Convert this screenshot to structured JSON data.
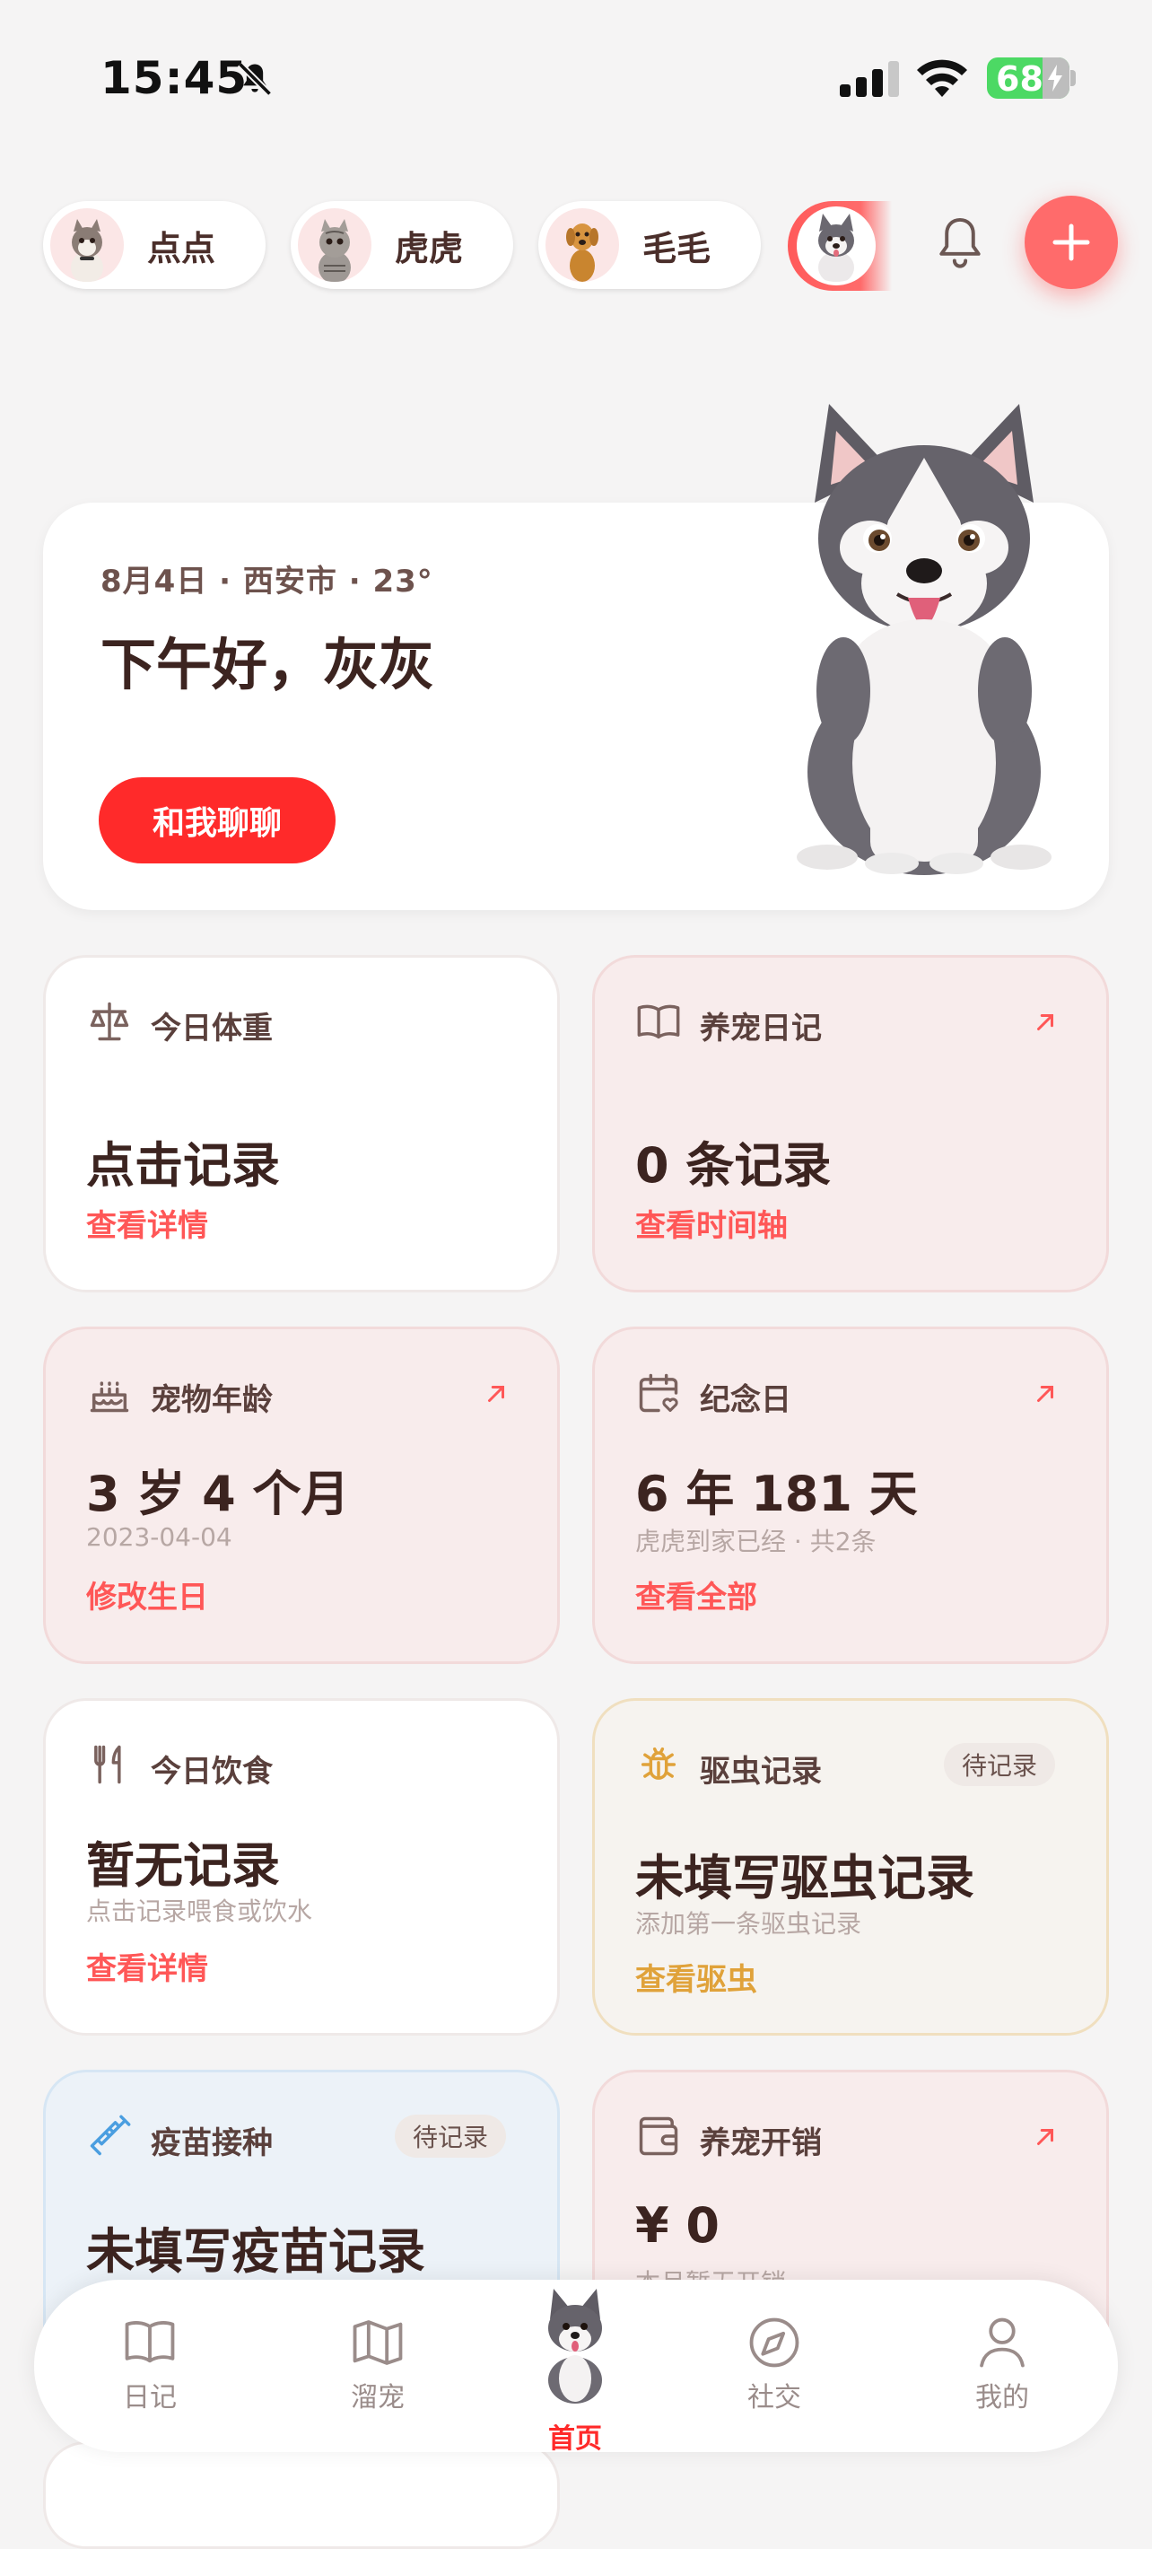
{
  "status_bar": {
    "time": "15:45",
    "battery": "68"
  },
  "pets": [
    {
      "name": "点点"
    },
    {
      "name": "虎虎"
    },
    {
      "name": "毛毛"
    }
  ],
  "hero": {
    "meta": "8月4日 · 西安市 · 23°",
    "greeting": "下午好，灰灰",
    "chat_button": "和我聊聊"
  },
  "cards": {
    "weight": {
      "label": "今日体重",
      "value": "点击记录",
      "link": "查看详情"
    },
    "diary": {
      "label": "养宠日记",
      "value": "0 条记录",
      "link": "查看时间轴"
    },
    "age": {
      "label": "宠物年龄",
      "value": "3 岁 4 个月",
      "sub": "2023-04-04",
      "link": "修改生日"
    },
    "anniversary": {
      "label": "纪念日",
      "value": "6 年 181 天",
      "sub": "虎虎到家已经 · 共2条",
      "link": "查看全部"
    },
    "diet": {
      "label": "今日饮食",
      "value": "暂无记录",
      "sub": "点击记录喂食或饮水",
      "link": "查看详情"
    },
    "deworm": {
      "label": "驱虫记录",
      "badge": "待记录",
      "value": "未填写驱虫记录",
      "sub": "添加第一条驱虫记录",
      "link": "查看驱虫"
    },
    "vaccine": {
      "label": "疫苗接种",
      "badge": "待记录",
      "value": "未填写疫苗记录"
    },
    "expense": {
      "label": "养宠开销",
      "value": "¥ 0",
      "sub": "本月暂无开销"
    }
  },
  "nav": {
    "items": [
      {
        "label": "日记"
      },
      {
        "label": "溜宠"
      },
      {
        "label": "首页"
      },
      {
        "label": "社交"
      },
      {
        "label": "我的"
      }
    ]
  },
  "colors": {
    "accent": "#ff2a2a",
    "link": "#ff5757",
    "orange": "#e0a23a"
  }
}
